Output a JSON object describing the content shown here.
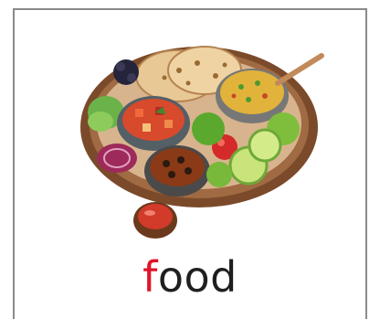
{
  "flashcard": {
    "word_first_letter": "f",
    "word_rest": "ood",
    "colors": {
      "first_letter": "#e0142a",
      "rest_letters": "#1f1f1f",
      "border": "#8a8a8a"
    },
    "image_icon": "indian-thali-food-illustration"
  }
}
